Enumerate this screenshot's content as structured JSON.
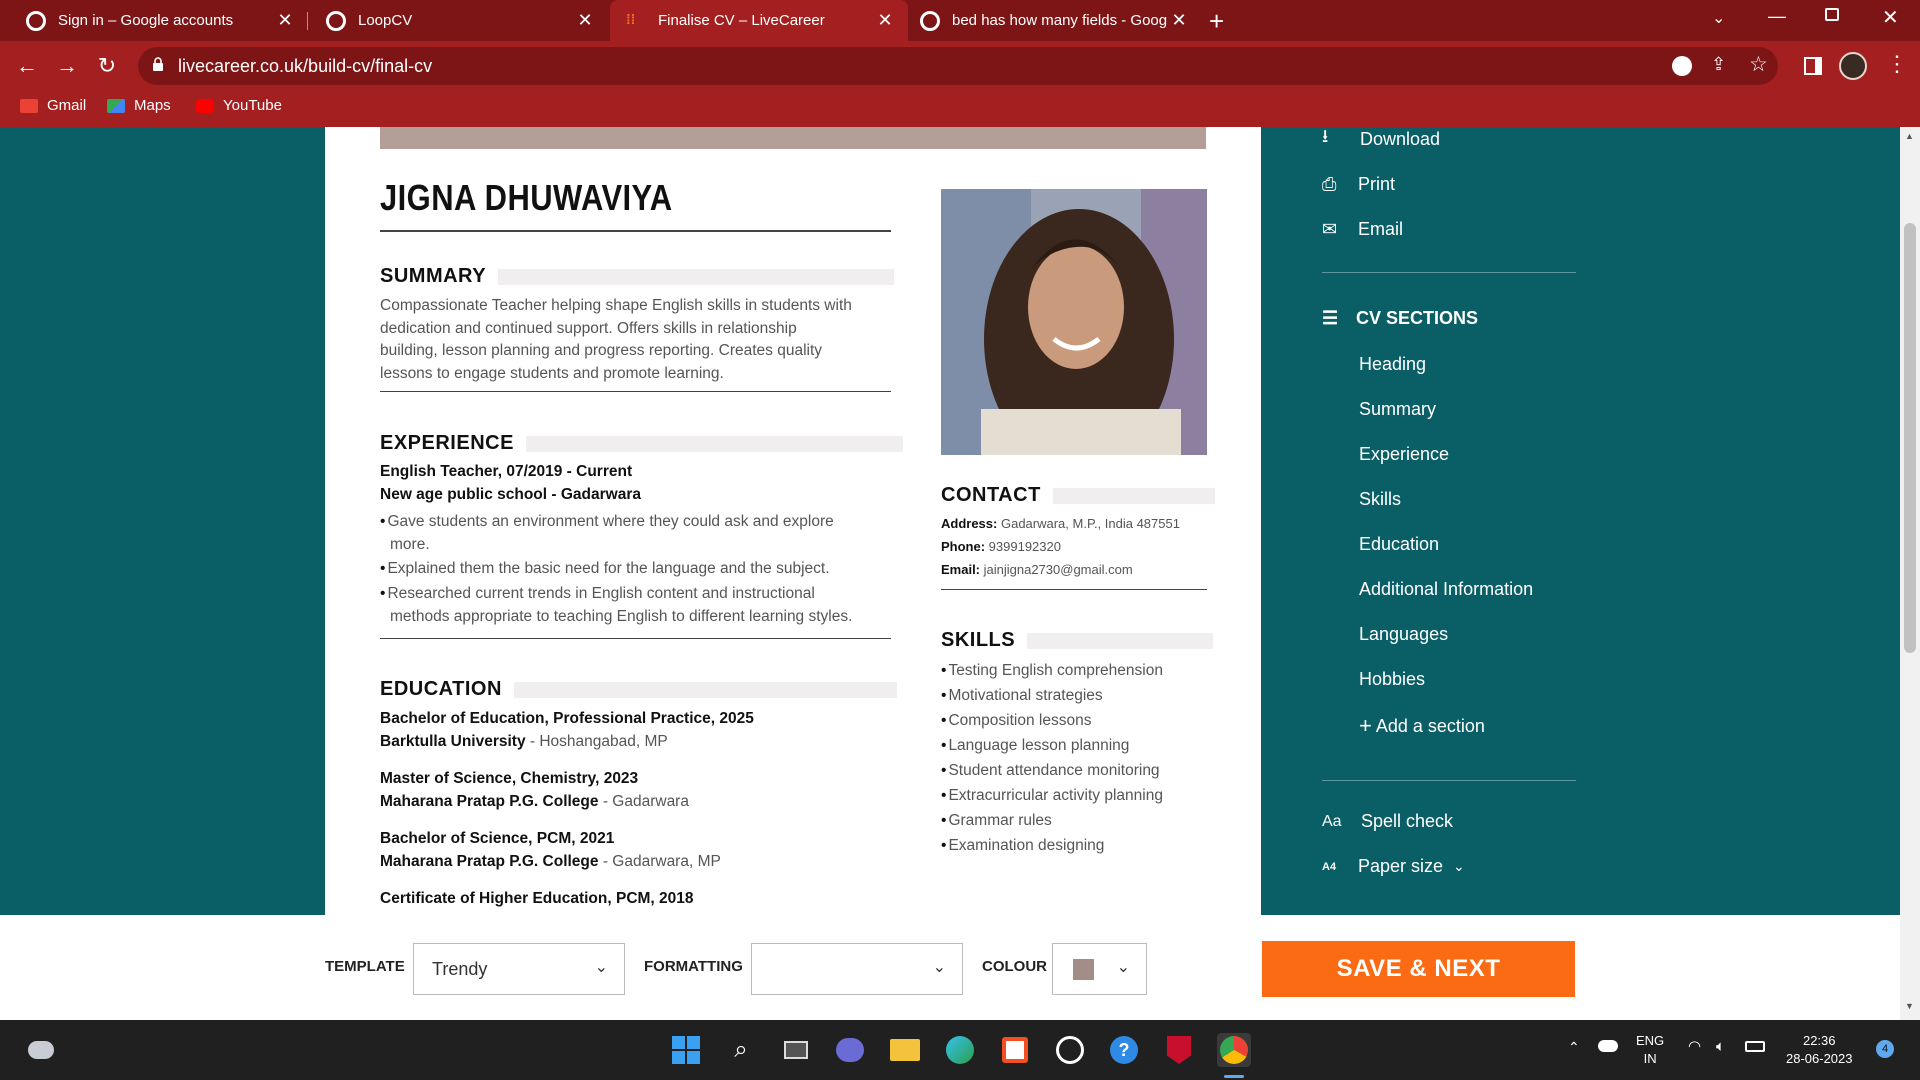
{
  "browser": {
    "tabs": [
      {
        "title": "Sign in – Google accounts"
      },
      {
        "title": "LoopCV"
      },
      {
        "title": "Finalise CV – LiveCareer"
      },
      {
        "title": "bed has how many fields - Google Search"
      }
    ],
    "url": "livecareer.co.uk/build-cv/final-cv",
    "bookmarks": [
      "Gmail",
      "Maps",
      "YouTube"
    ]
  },
  "cv": {
    "name": "JIGNA DHUWAVIYA",
    "summary_heading": "SUMMARY",
    "summary_lines": [
      "Compassionate Teacher helping shape English skills in students with",
      "dedication and continued support. Offers skills in relationship",
      "building, lesson planning and progress reporting. Creates quality",
      "lessons to engage students and promote learning."
    ],
    "experience_heading": "EXPERIENCE",
    "experience": {
      "role": "English Teacher",
      "dates": ", 07/2019 - Current",
      "employer": "New age public school - Gadarwara",
      "bullets": [
        [
          "Gave students an environment where they could ask and explore",
          "more."
        ],
        [
          "Explained them the basic need for the language and the subject."
        ],
        [
          "Researched current trends in English content and instructional",
          "methods appropriate to teaching English to different learning styles."
        ]
      ]
    },
    "education_heading": "EDUCATION",
    "education": [
      {
        "degree": "Bachelor of Education",
        "field": ", Professional Practice, 2025",
        "school": "Barktulla University",
        "location": " - Hoshangabad, MP"
      },
      {
        "degree": "Master of Science",
        "field": ", Chemistry, 2023",
        "school": "Maharana Pratap P.G. College",
        "location": " - Gadarwara"
      },
      {
        "degree": "Bachelor of Science",
        "field": ", PCM, 2021",
        "school": "Maharana Pratap P.G. College",
        "location": " - Gadarwara, MP"
      },
      {
        "degree": "Certificate of Higher Education",
        "field": ", PCM, 2018",
        "school": "",
        "location": ""
      }
    ],
    "contact_heading": "CONTACT",
    "contact": {
      "address_label": "Address:",
      "address": " Gadarwara, M.P., India 487551",
      "phone_label": "Phone:",
      "phone": " 9399192320",
      "email_label": "Email:",
      "email": " jainjigna2730@gmail.com"
    },
    "skills_heading": "SKILLS",
    "skills": [
      "Testing English comprehension",
      "Motivational strategies",
      "Composition lessons",
      "Language lesson planning",
      "Student attendance monitoring",
      "Extracurricular activity planning",
      "Grammar rules",
      "Examination designing"
    ]
  },
  "panel": {
    "download": "Download",
    "print": "Print",
    "email": "Email",
    "sections_title": "CV SECTIONS",
    "sections": [
      "Heading",
      "Summary",
      "Experience",
      "Skills",
      "Education",
      "Additional Information",
      "Languages",
      "Hobbies"
    ],
    "add_section": "Add a section",
    "spell_check": "Spell check",
    "paper_size": "Paper size"
  },
  "bottom": {
    "template_label": "TEMPLATE",
    "template_value": "Trendy",
    "formatting_label": "FORMATTING",
    "formatting_value": "",
    "colour_label": "COLOUR",
    "colour_swatch": "#a38d88",
    "save_label": "SAVE & NEXT"
  },
  "taskbar": {
    "lang1": "ENG",
    "lang2": "IN",
    "time": "22:36",
    "date": "28-06-2023",
    "notifications": "4"
  },
  "colors": {
    "chrome_frame": "#7d1517",
    "chrome_toolbar": "#a41f20",
    "page_bg": "#0a5f66",
    "accent": "#fb6b14",
    "cv_bar": "#b49e98"
  }
}
